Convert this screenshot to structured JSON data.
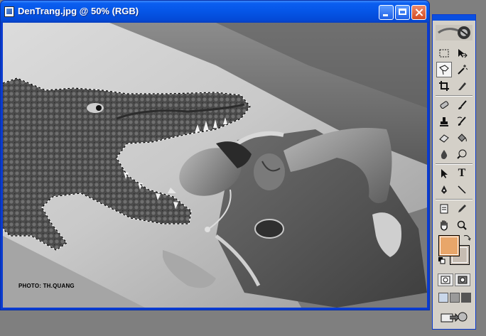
{
  "window": {
    "title": "DenTrang.jpg @ 50% (RGB)",
    "buttons": [
      "minimize",
      "maximize",
      "close"
    ]
  },
  "canvas": {
    "photo_credit": "PHOTO: TH.QUANG",
    "selection": "crocodile head outlined with a marching-ants selection"
  },
  "toolbox": {
    "tools": [
      "marquee-icon",
      "move-icon",
      "polygonal-lasso-icon",
      "magic-wand-icon",
      "crop-icon",
      "slice-icon",
      "healing-brush-icon",
      "brush-icon",
      "clone-stamp-icon",
      "history-brush-icon",
      "eraser-icon",
      "paint-bucket-icon",
      "blur-icon",
      "dodge-icon",
      "path-selection-icon",
      "type-icon",
      "pen-icon",
      "line-icon",
      "notes-icon",
      "eyedropper-icon",
      "hand-icon",
      "zoom-icon"
    ],
    "type_tool_label": "T",
    "active_tool": "polygonal-lasso-icon",
    "foreground_color": "#e8a66a",
    "background_color": "#c6bcb2"
  }
}
